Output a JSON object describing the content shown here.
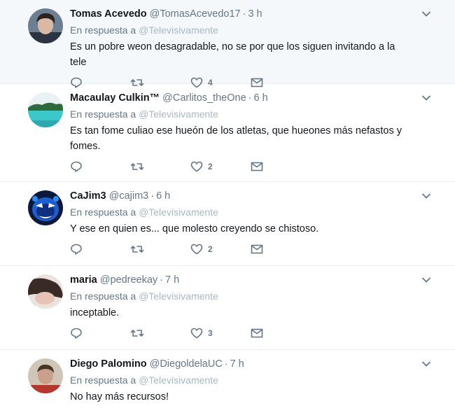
{
  "tweets": [
    {
      "name": "Tomas Acevedo",
      "handle": "@TomasAcevedo17",
      "time": "3 h",
      "reply_prefix": "En respuesta a",
      "reply_to": "@Televisivamente",
      "text": "Es un pobre weon desagradable, no se por que los siguen invitando a la tele",
      "likes": "4",
      "avatar": "portrait-dark-hair"
    },
    {
      "name": "Macaulay Culkin™",
      "handle": "@Carlitos_theOne",
      "time": "6 h",
      "reply_prefix": "En respuesta a",
      "reply_to": "@Televisivamente",
      "text": "Es tan fome culiao ese hueón de los atletas, que hueones más nefastos y fomes.",
      "likes": "2",
      "avatar": "landscape-lake"
    },
    {
      "name": "CaJim3",
      "handle": "@cajim3",
      "time": "6 h",
      "reply_prefix": "En respuesta a",
      "reply_to": "@Televisivamente",
      "text": "Y ese en quien es... que molesto creyendo se chistoso.",
      "likes": "2",
      "avatar": "blue-cartoon-character"
    },
    {
      "name": "maria",
      "handle": "@pedreekay",
      "time": "7 h",
      "reply_prefix": "En respuesta a",
      "reply_to": "@Televisivamente",
      "text": "inceptable.",
      "likes": "3",
      "avatar": "portrait-lying-down"
    },
    {
      "name": "Diego Palomino",
      "handle": "@DiegoldelaUC",
      "time": "7 h",
      "reply_prefix": "En respuesta a",
      "reply_to": "@Televisivamente",
      "text": "No hay más recursos!",
      "likes": "",
      "avatar": "portrait-man"
    }
  ],
  "separator": "·",
  "colors": {
    "icon": "#657786",
    "mention": "#aab8c2",
    "border": "#e6ecf0",
    "first_row_bg": "#f5f8fa"
  }
}
